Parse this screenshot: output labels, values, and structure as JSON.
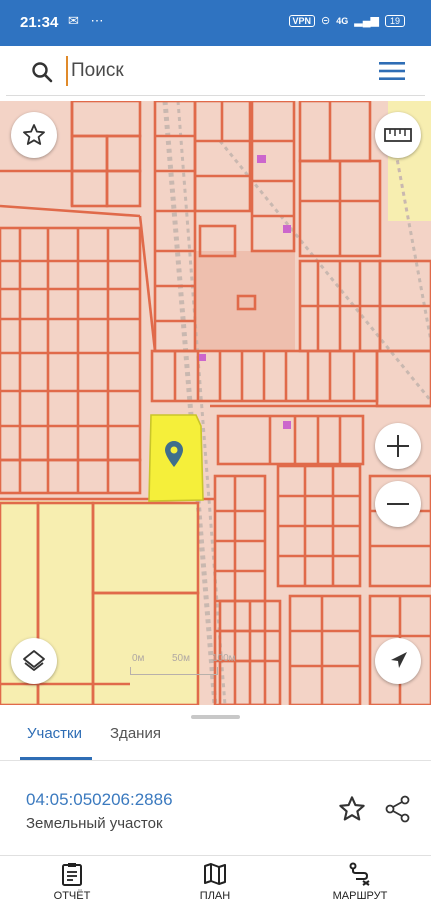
{
  "status_bar": {
    "time": "21:34",
    "left_icons": "✉ ⋯",
    "vpn": "VPN",
    "network": "4G",
    "battery": "19"
  },
  "search": {
    "placeholder": "Поиск"
  },
  "map": {
    "scale": {
      "label_0": "0м",
      "label_50": "50м",
      "label_100": "100м"
    },
    "colors": {
      "background": "#f3d3c6",
      "parcel_line": "#e06a4a",
      "selected_parcel": "#f5ef3a",
      "zone_yellow": "#f7eeb0",
      "marker": "#3f6e8c",
      "building": "#cc66cc"
    }
  },
  "panel": {
    "tabs": [
      {
        "label": "Участки"
      },
      {
        "label": "Здания"
      }
    ],
    "active_tab": "Участки",
    "cadastral_number": "04:05:050206:2886",
    "parcel_type": "Земельный участок"
  },
  "bottom_nav": [
    {
      "label": "ОТЧЁТ",
      "icon": "report-icon"
    },
    {
      "label": "ПЛАН",
      "icon": "map-plan-icon"
    },
    {
      "label": "МАРШРУТ",
      "icon": "route-icon"
    }
  ],
  "colors": {
    "status_bar": "#2f73c1",
    "accent": "#2e6db5"
  }
}
